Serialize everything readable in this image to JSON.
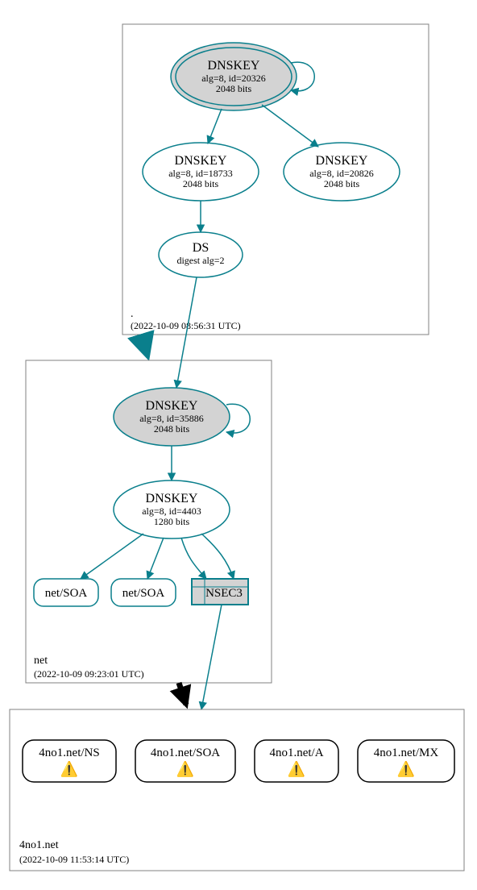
{
  "zones": {
    "root": {
      "label": ".",
      "timestamp": "(2022-10-09 08:56:31 UTC)"
    },
    "net": {
      "label": "net",
      "timestamp": "(2022-10-09 09:23:01 UTC)"
    },
    "target": {
      "label": "4no1.net",
      "timestamp": "(2022-10-09 11:53:14 UTC)"
    }
  },
  "nodes": {
    "root_ksk": {
      "title": "DNSKEY",
      "line2": "alg=8, id=20326",
      "line3": "2048 bits"
    },
    "root_zsk": {
      "title": "DNSKEY",
      "line2": "alg=8, id=18733",
      "line3": "2048 bits"
    },
    "root_dnskey3": {
      "title": "DNSKEY",
      "line2": "alg=8, id=20826",
      "line3": "2048 bits"
    },
    "root_ds": {
      "title": "DS",
      "line2": "digest alg=2"
    },
    "net_ksk": {
      "title": "DNSKEY",
      "line2": "alg=8, id=35886",
      "line3": "2048 bits"
    },
    "net_zsk": {
      "title": "DNSKEY",
      "line2": "alg=8, id=4403",
      "line3": "1280 bits"
    },
    "net_soa1": {
      "title": "net/SOA"
    },
    "net_soa2": {
      "title": "net/SOA"
    },
    "net_nsec3": {
      "title": "NSEC3"
    },
    "t_ns": {
      "title": "4no1.net/NS"
    },
    "t_soa": {
      "title": "4no1.net/SOA"
    },
    "t_a": {
      "title": "4no1.net/A"
    },
    "t_mx": {
      "title": "4no1.net/MX"
    }
  }
}
